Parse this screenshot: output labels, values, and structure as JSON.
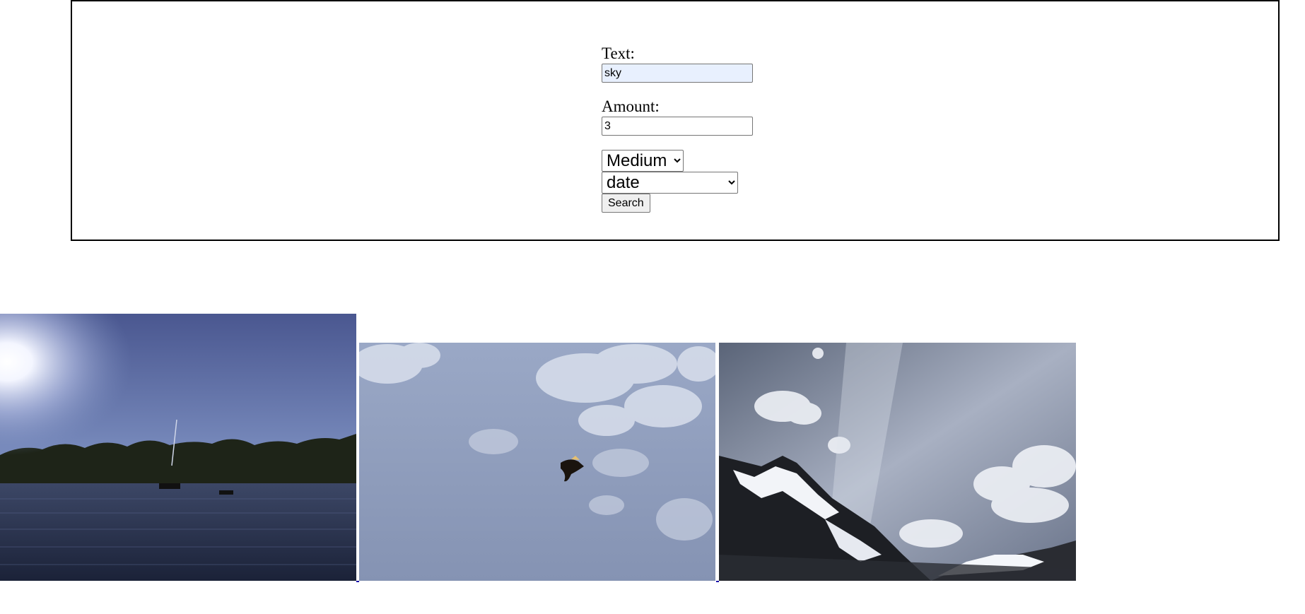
{
  "form": {
    "text_label": "Text:",
    "text_value": "sky",
    "amount_label": "Amount:",
    "amount_value": "3",
    "size_selected": "Medium",
    "sort_selected": "date",
    "search_label": "Search"
  },
  "results": {
    "count": 3,
    "images": [
      {
        "subject": "sun over lake with trees"
      },
      {
        "subject": "bird in cloudy sky"
      },
      {
        "subject": "snowy mountains under clouds"
      }
    ]
  }
}
